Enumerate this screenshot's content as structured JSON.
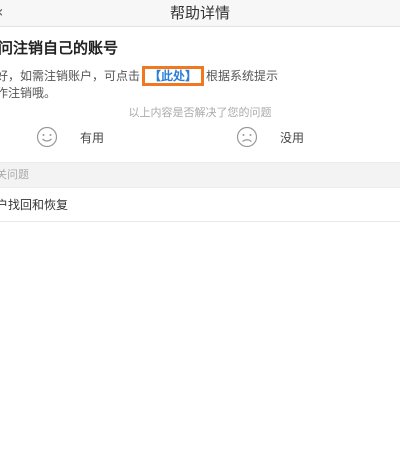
{
  "header": {
    "title": "帮助详情",
    "back_icon": "chevron-left-icon"
  },
  "article": {
    "title": "问注销自己的账号",
    "line1_before": "好，如需注销账户，可点击",
    "link_text": "【此处】",
    "line1_after": "根据系统提示",
    "line2": "作注销哦。"
  },
  "feedback": {
    "question": "以上内容是否解决了您的问题",
    "useful_label": "有用",
    "useless_label": "没用",
    "useful_icon": "smile-icon",
    "useless_icon": "frown-icon"
  },
  "related": {
    "section_label": "关问题",
    "items": [
      {
        "label": "户找回和恢复"
      }
    ]
  },
  "colors": {
    "highlight_border": "#f07820",
    "link": "#2a7dd8"
  }
}
